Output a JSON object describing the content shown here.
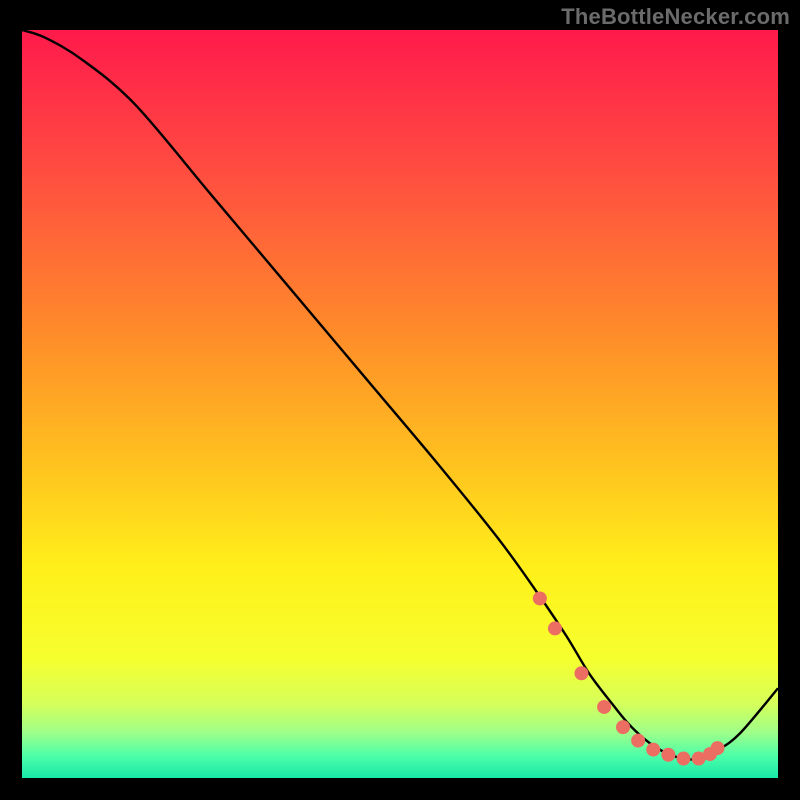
{
  "attribution": "TheBottleNecker.com",
  "chart_data": {
    "type": "line",
    "title": "",
    "xlabel": "",
    "ylabel": "",
    "xlim": [
      0,
      100
    ],
    "ylim": [
      0,
      100
    ],
    "series": [
      {
        "name": "curve",
        "x": [
          0,
          3,
          8,
          15,
          25,
          35,
          45,
          55,
          63,
          68,
          72,
          75,
          78,
          80,
          82,
          84,
          86,
          88,
          90,
          92,
          95,
          100
        ],
        "y": [
          100,
          99,
          96,
          90,
          78,
          66,
          54,
          42,
          32,
          25,
          19,
          14,
          10,
          7.5,
          5.5,
          4,
          3,
          2.5,
          2.7,
          3.7,
          6,
          12
        ]
      }
    ],
    "markers": {
      "name": "dots",
      "x": [
        68.5,
        70.5,
        74,
        77,
        79.5,
        81.5,
        83.5,
        85.5,
        87.5,
        89.5,
        91.0,
        92.0
      ],
      "y": [
        24,
        20,
        14,
        9.5,
        6.8,
        5.0,
        3.8,
        3.1,
        2.6,
        2.6,
        3.2,
        4.0
      ],
      "color": "#ec6e63",
      "radius": 7
    },
    "background_gradient": {
      "stops": [
        {
          "offset": 0.0,
          "color": "#ff1a4b"
        },
        {
          "offset": 0.2,
          "color": "#ff5040"
        },
        {
          "offset": 0.4,
          "color": "#ff8a2a"
        },
        {
          "offset": 0.58,
          "color": "#ffc21f"
        },
        {
          "offset": 0.72,
          "color": "#fff01a"
        },
        {
          "offset": 0.84,
          "color": "#f6ff2e"
        },
        {
          "offset": 0.9,
          "color": "#d6ff5a"
        },
        {
          "offset": 0.94,
          "color": "#9dff8a"
        },
        {
          "offset": 0.97,
          "color": "#4effa8"
        },
        {
          "offset": 1.0,
          "color": "#18e7a8"
        }
      ]
    }
  }
}
